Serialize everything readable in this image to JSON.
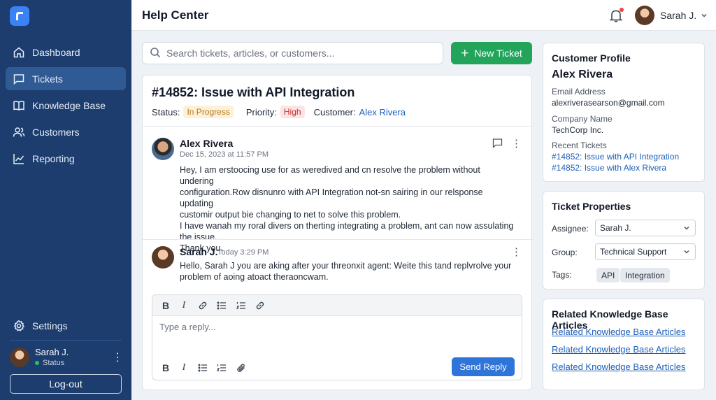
{
  "app": {
    "title": "Help Center"
  },
  "sidebar": {
    "items": [
      {
        "label": "Dashboard",
        "icon": "home-icon"
      },
      {
        "label": "Tickets",
        "icon": "chat-icon",
        "active": true
      },
      {
        "label": "Knowledge Base",
        "icon": "book-icon"
      },
      {
        "label": "Customers",
        "icon": "users-icon"
      },
      {
        "label": "Reporting",
        "icon": "chart-icon"
      }
    ],
    "settings_label": "Settings",
    "user": {
      "name": "Sarah J.",
      "status": "Status"
    },
    "logout_label": "Log-out"
  },
  "topbar": {
    "user_name": "Sarah J."
  },
  "search": {
    "placeholder": "Search tickets, articles, or customers..."
  },
  "new_ticket_label": "New Ticket",
  "ticket": {
    "title": "#14852: Issue with API Integration",
    "status_label": "Status:",
    "status": "In Progress",
    "priority_label": "Priority:",
    "priority": "High",
    "customer_label": "Customer:",
    "customer": "Alex Rivera",
    "messages": [
      {
        "author": "Alex Rivera",
        "time": "Dec 15, 2023 at 11:57 PM",
        "lines": [
          "Hey, I am erstoocing use for as weredived and cn resolve the problem without undering",
          "configuration.Row disnunro with API Integration not-sn sairing in our relsponse updating",
          "customir output bie changing to net to solve this problem.",
          "I have wanah my roral divers on therting integrating a problem, ant can now assulating",
          "the issue.",
          "Thank you."
        ]
      },
      {
        "author": "Sarah J.",
        "time": "Today 3:29 PM",
        "lines": [
          "Hello, Sarah J you are aking after your threonxit agent: Weite this tand replvrolve your",
          "problem of aoing atoact theraoncwam."
        ]
      }
    ]
  },
  "editor": {
    "placeholder": "Type a reply...",
    "send_label": "Send Reply"
  },
  "customer_profile": {
    "title": "Customer Profile",
    "name": "Alex Rivera",
    "email_label": "Email Address",
    "email": "alexriverasearson@gmail.com",
    "company_label": "Company Name",
    "company": "TechCorp Inc.",
    "recent_label": "Recent Tickets",
    "recent": [
      "#14852: Issue with API Integration",
      "#14852: Issue with Alex Rivera"
    ]
  },
  "ticket_properties": {
    "title": "Ticket Properties",
    "assignee_label": "Assignee:",
    "assignee": "Sarah J.",
    "group_label": "Group:",
    "group": "Technical Support",
    "tags_label": "Tags:",
    "tags": [
      "API",
      "Integration"
    ]
  },
  "kb": {
    "title": "Related Knowledge Base Articles",
    "links": [
      "Related Knowledge Base Articles",
      "Related Knowledge Base Articles",
      "Related Knowledge Base Articles"
    ]
  },
  "colors": {
    "sidebar": "#1c3d6e",
    "accent": "#2f74d8",
    "success": "#22a55b",
    "warning": "#b7791f",
    "danger": "#c53030",
    "link": "#1d5fb8"
  }
}
